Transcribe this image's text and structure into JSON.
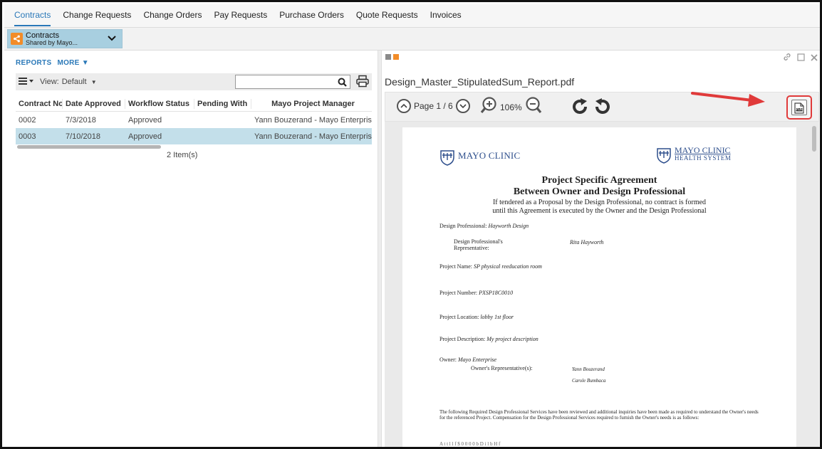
{
  "tabs": [
    {
      "label": "Contracts",
      "active": true
    },
    {
      "label": "Change Requests"
    },
    {
      "label": "Change Orders"
    },
    {
      "label": "Pay Requests"
    },
    {
      "label": "Purchase Orders"
    },
    {
      "label": "Quote Requests"
    },
    {
      "label": "Invoices"
    }
  ],
  "context": {
    "title": "Contracts",
    "subtitle": "Shared by Mayo..."
  },
  "left": {
    "reports_label": "REPORTS",
    "more_label": "MORE",
    "view_label": "View:",
    "view_value": "Default",
    "search_value": "",
    "columns": [
      "Contract No",
      "Date Approved",
      "Workflow Status",
      "Pending With",
      "Mayo Project Manager"
    ],
    "rows": [
      {
        "contract_no": "0002",
        "date_approved": "7/3/2018",
        "status": "Approved",
        "pending_with": "",
        "manager": "Yann Bouzerand - Mayo Enterpris"
      },
      {
        "contract_no": "0003",
        "date_approved": "7/10/2018",
        "status": "Approved",
        "pending_with": "",
        "manager": "Yann Bouzerand - Mayo Enterpris"
      }
    ],
    "item_count": "2 Item(s)"
  },
  "viewer": {
    "filename": "Design_Master_StipulatedSum_Report.pdf",
    "page_label": "Page 1 / 6",
    "zoom_label": "106%",
    "pdf_icon_text": "PDF",
    "square_colors": [
      "#8a8a8a",
      "#f28c28"
    ]
  },
  "document": {
    "logo_left": "MAYO CLINIC",
    "logo_right_main": "MAYO CLINIC",
    "logo_right_sub": "HEALTH SYSTEM",
    "title_line1": "Project Specific Agreement",
    "title_line2": "Between Owner and Design Professional",
    "note_line1": "If tendered as a Proposal by the Design Professional, no contract is formed",
    "note_line2": "until this Agreement is executed by the Owner and the Design Professional",
    "design_professional_label": "Design Professional:",
    "design_professional_value": "Hayworth Design",
    "representative_label": "Design Professional's Representative:",
    "representative_value": "Rita Hayworth",
    "project_name_label": "Project Name:",
    "project_name_value": "SP physical reeducation room",
    "project_number_label": "Project Number:",
    "project_number_value": "PXSP18C0010",
    "project_location_label": "Project Location:",
    "project_location_value": "lobby 1st floor",
    "project_description_label": "Project Description:",
    "project_description_value": "My project description",
    "owner_label": "Owner:",
    "owner_value": "Mayo Enterprise",
    "owner_rep_label": "Owner's Representative(s):",
    "owner_rep_value1": "Yann Bouzerand",
    "owner_rep_value2": "Carole Bumbaca",
    "paragraph": "The following Required Design Professional Services have been reviewed and additional inquiries have been made as required to understand the Owner's needs for the referenced Project.   Compensation for the Design Professional Services required to furnish the Owner's needs is as follows:",
    "cut_line": "A t   t     l     l         f $ 0  0 0 0   b   D   i   l    b    H   f"
  },
  "colors": {
    "accent": "#2a78b8",
    "selected_row": "#c3dfea",
    "callout": "#e03a3a",
    "share_badge": "#f28c28"
  }
}
